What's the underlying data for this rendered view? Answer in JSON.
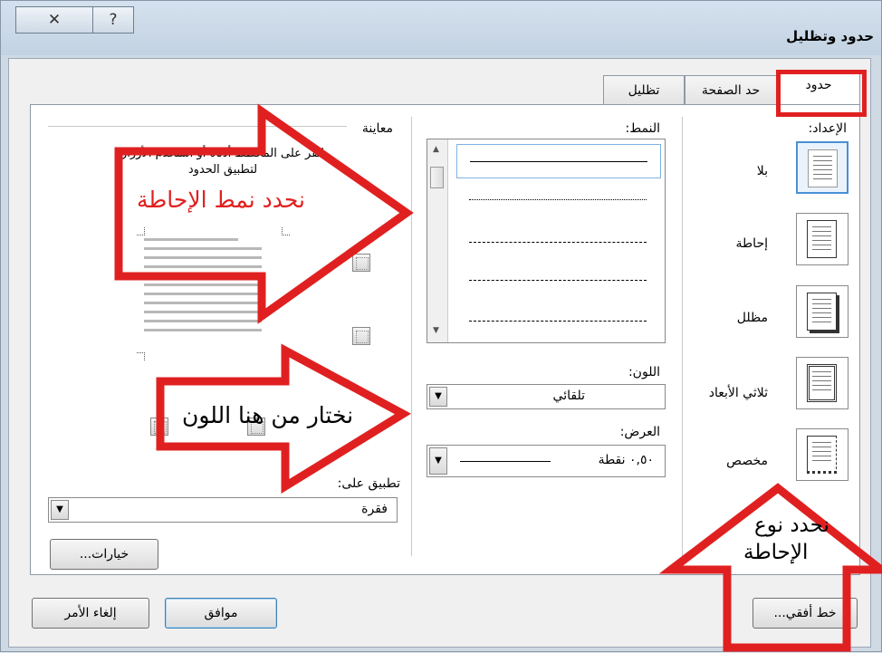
{
  "window": {
    "title": "حدود وتظليل",
    "close_glyph": "✕",
    "help_glyph": "?"
  },
  "tabs": [
    {
      "label": "حدود",
      "active": true
    },
    {
      "label": "حد الصفحة",
      "active": false
    },
    {
      "label": "تظليل",
      "active": false
    }
  ],
  "settings": {
    "label": "الإعداد:",
    "items": [
      {
        "label": "بلا"
      },
      {
        "label": "إحاطة"
      },
      {
        "label": "مظلل"
      },
      {
        "label": "ثلاثي الأبعاد"
      },
      {
        "label": "مخصص"
      }
    ]
  },
  "style": {
    "label": "النمط:"
  },
  "color": {
    "label": "اللون:",
    "value": "تلقائي"
  },
  "width": {
    "label": "العرض:",
    "value": "٠,٥٠ نقطة"
  },
  "preview": {
    "label": "معاينة",
    "hint": "انقر على المخطط أدناه أو استخدم الأزرار لتطبيق الحدود"
  },
  "apply_to": {
    "label": "تطبيق على:",
    "value": "فقرة"
  },
  "buttons": {
    "options": "خيارات...",
    "horizontal_line": "خط أفقي...",
    "ok": "موافق",
    "cancel": "إلغاء الأمر"
  },
  "annotations": {
    "style_note": "نحدد نمط الإحاطة",
    "color_note": "نختار من هنا اللون",
    "type_note_line1": "نحدد نوع",
    "type_note_line2": "الإحاطة",
    "accent_color": "#e02020"
  }
}
